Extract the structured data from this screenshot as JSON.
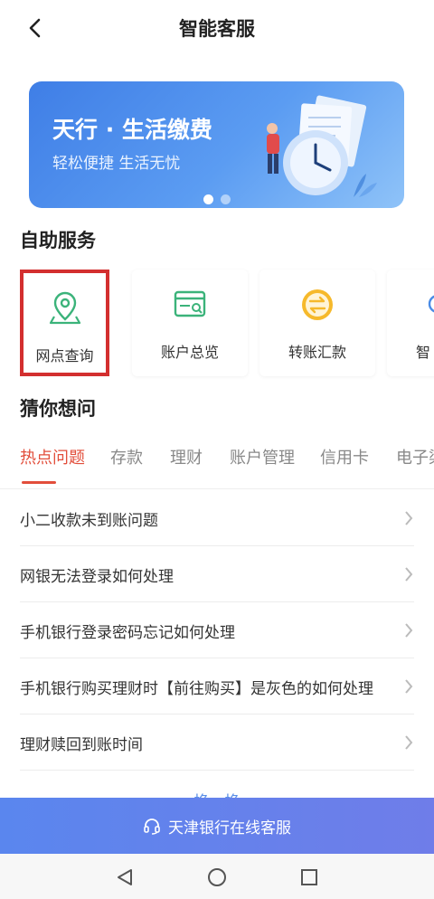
{
  "header": {
    "title": "智能客服"
  },
  "banner": {
    "title": "天行 · 生活缴费",
    "subtitle": "轻松便捷 生活无忧",
    "slide_count": 2,
    "active_slide": 1
  },
  "services_section": {
    "title": "自助服务",
    "items": [
      {
        "label": "网点查询",
        "icon": "location-pin-icon"
      },
      {
        "label": "账户总览",
        "icon": "account-card-icon"
      },
      {
        "label": "转账汇款",
        "icon": "transfer-icon"
      },
      {
        "label": "智",
        "icon": "smart-icon"
      }
    ],
    "selected_index": 0
  },
  "guess_section": {
    "title": "猜你想问",
    "tabs": [
      "热点问题",
      "存款",
      "理财",
      "账户管理",
      "信用卡",
      "电子渠"
    ],
    "active_tab": 0,
    "questions": [
      "小二收款未到账问题",
      "网银无法登录如何处理",
      "手机银行登录密码忘记如何处理",
      "手机银行购买理财时【前往购买】是灰色的如何处理",
      "理财赎回到账时间"
    ],
    "more_label": "换一换"
  },
  "online_service": {
    "label": "天津银行在线客服",
    "icon": "headset-icon"
  },
  "colors": {
    "accent_red": "#e24e3b",
    "accent_blue": "#5a86ee",
    "selection_box": "#d32f2f"
  }
}
